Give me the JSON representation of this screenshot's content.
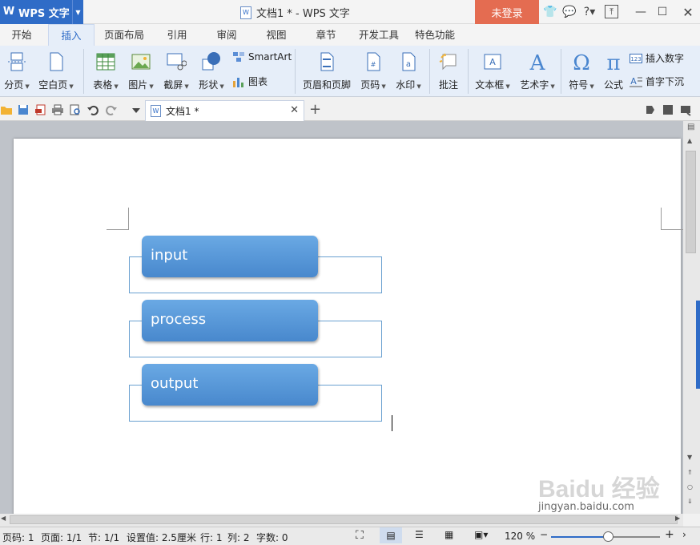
{
  "titlebar": {
    "app_name": "WPS 文字",
    "doc_title": "文档1 * - WPS 文字",
    "login_label": "未登录"
  },
  "menu_tabs": [
    "开始",
    "插入",
    "页面布局",
    "引用",
    "审阅",
    "视图",
    "章节",
    "开发工具",
    "特色功能"
  ],
  "active_tab": "插入",
  "ribbon": {
    "page_break": "分页",
    "blank_page": "空白页",
    "table": "表格",
    "picture": "图片",
    "screenshot": "截屏",
    "shape": "形状",
    "smartart": "SmartArt",
    "chart": "图表",
    "header_footer": "页眉和页脚",
    "page_number": "页码",
    "watermark": "水印",
    "comment": "批注",
    "textbox": "文本框",
    "wordart": "艺术字",
    "symbol": "符号",
    "formula": "公式",
    "insert_number": "插入数字",
    "drop_cap": "首字下沉"
  },
  "doc_tab": {
    "label": "文档1 *"
  },
  "document": {
    "blocks": [
      "input",
      "process",
      "output"
    ]
  },
  "statusbar": {
    "page": "页码: 1",
    "pages": "页面: 1/1",
    "section": "节: 1/1",
    "setting": "设置值: 2.5厘米",
    "row": "行: 1",
    "col": "列: 2",
    "wordcount": "字数: 0",
    "zoom": "120 %",
    "zoom_fraction": 0.53
  },
  "watermark": {
    "brand": "Baidu 经验",
    "url": "jingyan.baidu.com"
  },
  "colors": {
    "accent": "#2f6cc7",
    "login": "#e46c51",
    "block": "#5a9ad9"
  }
}
